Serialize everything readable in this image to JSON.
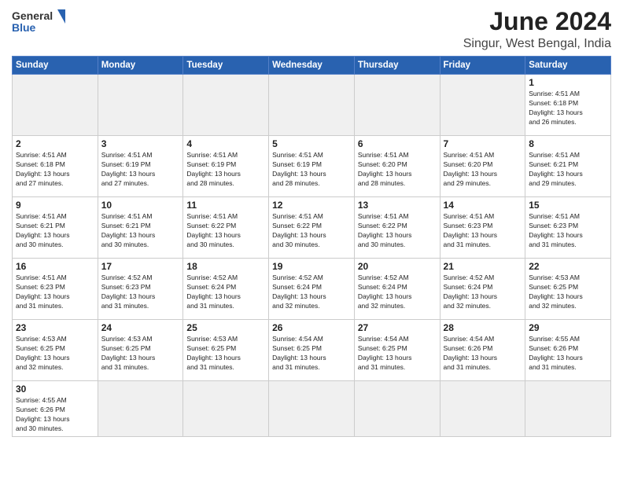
{
  "header": {
    "logo_general": "General",
    "logo_blue": "Blue",
    "month_title": "June 2024",
    "location": "Singur, West Bengal, India"
  },
  "weekdays": [
    "Sunday",
    "Monday",
    "Tuesday",
    "Wednesday",
    "Thursday",
    "Friday",
    "Saturday"
  ],
  "weeks": [
    [
      {
        "day": "",
        "info": ""
      },
      {
        "day": "",
        "info": ""
      },
      {
        "day": "",
        "info": ""
      },
      {
        "day": "",
        "info": ""
      },
      {
        "day": "",
        "info": ""
      },
      {
        "day": "",
        "info": ""
      },
      {
        "day": "1",
        "info": "Sunrise: 4:51 AM\nSunset: 6:18 PM\nDaylight: 13 hours\nand 26 minutes."
      }
    ],
    [
      {
        "day": "2",
        "info": "Sunrise: 4:51 AM\nSunset: 6:18 PM\nDaylight: 13 hours\nand 27 minutes."
      },
      {
        "day": "3",
        "info": "Sunrise: 4:51 AM\nSunset: 6:19 PM\nDaylight: 13 hours\nand 27 minutes."
      },
      {
        "day": "4",
        "info": "Sunrise: 4:51 AM\nSunset: 6:19 PM\nDaylight: 13 hours\nand 28 minutes."
      },
      {
        "day": "5",
        "info": "Sunrise: 4:51 AM\nSunset: 6:19 PM\nDaylight: 13 hours\nand 28 minutes."
      },
      {
        "day": "6",
        "info": "Sunrise: 4:51 AM\nSunset: 6:20 PM\nDaylight: 13 hours\nand 28 minutes."
      },
      {
        "day": "7",
        "info": "Sunrise: 4:51 AM\nSunset: 6:20 PM\nDaylight: 13 hours\nand 29 minutes."
      },
      {
        "day": "8",
        "info": "Sunrise: 4:51 AM\nSunset: 6:21 PM\nDaylight: 13 hours\nand 29 minutes."
      }
    ],
    [
      {
        "day": "9",
        "info": "Sunrise: 4:51 AM\nSunset: 6:21 PM\nDaylight: 13 hours\nand 30 minutes."
      },
      {
        "day": "10",
        "info": "Sunrise: 4:51 AM\nSunset: 6:21 PM\nDaylight: 13 hours\nand 30 minutes."
      },
      {
        "day": "11",
        "info": "Sunrise: 4:51 AM\nSunset: 6:22 PM\nDaylight: 13 hours\nand 30 minutes."
      },
      {
        "day": "12",
        "info": "Sunrise: 4:51 AM\nSunset: 6:22 PM\nDaylight: 13 hours\nand 30 minutes."
      },
      {
        "day": "13",
        "info": "Sunrise: 4:51 AM\nSunset: 6:22 PM\nDaylight: 13 hours\nand 30 minutes."
      },
      {
        "day": "14",
        "info": "Sunrise: 4:51 AM\nSunset: 6:23 PM\nDaylight: 13 hours\nand 31 minutes."
      },
      {
        "day": "15",
        "info": "Sunrise: 4:51 AM\nSunset: 6:23 PM\nDaylight: 13 hours\nand 31 minutes."
      }
    ],
    [
      {
        "day": "16",
        "info": "Sunrise: 4:51 AM\nSunset: 6:23 PM\nDaylight: 13 hours\nand 31 minutes."
      },
      {
        "day": "17",
        "info": "Sunrise: 4:52 AM\nSunset: 6:23 PM\nDaylight: 13 hours\nand 31 minutes."
      },
      {
        "day": "18",
        "info": "Sunrise: 4:52 AM\nSunset: 6:24 PM\nDaylight: 13 hours\nand 31 minutes."
      },
      {
        "day": "19",
        "info": "Sunrise: 4:52 AM\nSunset: 6:24 PM\nDaylight: 13 hours\nand 32 minutes."
      },
      {
        "day": "20",
        "info": "Sunrise: 4:52 AM\nSunset: 6:24 PM\nDaylight: 13 hours\nand 32 minutes."
      },
      {
        "day": "21",
        "info": "Sunrise: 4:52 AM\nSunset: 6:24 PM\nDaylight: 13 hours\nand 32 minutes."
      },
      {
        "day": "22",
        "info": "Sunrise: 4:53 AM\nSunset: 6:25 PM\nDaylight: 13 hours\nand 32 minutes."
      }
    ],
    [
      {
        "day": "23",
        "info": "Sunrise: 4:53 AM\nSunset: 6:25 PM\nDaylight: 13 hours\nand 32 minutes."
      },
      {
        "day": "24",
        "info": "Sunrise: 4:53 AM\nSunset: 6:25 PM\nDaylight: 13 hours\nand 31 minutes."
      },
      {
        "day": "25",
        "info": "Sunrise: 4:53 AM\nSunset: 6:25 PM\nDaylight: 13 hours\nand 31 minutes."
      },
      {
        "day": "26",
        "info": "Sunrise: 4:54 AM\nSunset: 6:25 PM\nDaylight: 13 hours\nand 31 minutes."
      },
      {
        "day": "27",
        "info": "Sunrise: 4:54 AM\nSunset: 6:25 PM\nDaylight: 13 hours\nand 31 minutes."
      },
      {
        "day": "28",
        "info": "Sunrise: 4:54 AM\nSunset: 6:26 PM\nDaylight: 13 hours\nand 31 minutes."
      },
      {
        "day": "29",
        "info": "Sunrise: 4:55 AM\nSunset: 6:26 PM\nDaylight: 13 hours\nand 31 minutes."
      }
    ],
    [
      {
        "day": "30",
        "info": "Sunrise: 4:55 AM\nSunset: 6:26 PM\nDaylight: 13 hours\nand 30 minutes."
      },
      {
        "day": "",
        "info": ""
      },
      {
        "day": "",
        "info": ""
      },
      {
        "day": "",
        "info": ""
      },
      {
        "day": "",
        "info": ""
      },
      {
        "day": "",
        "info": ""
      },
      {
        "day": "",
        "info": ""
      }
    ]
  ]
}
